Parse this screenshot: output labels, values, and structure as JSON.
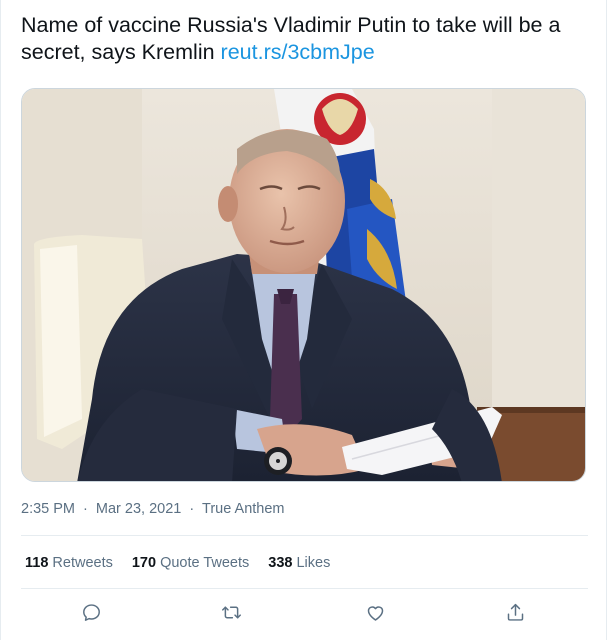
{
  "tweet": {
    "text": "Name of vaccine Russia's Vladimir Putin to take will be a secret, says Kremlin",
    "link": "reut.rs/3cbmJpe",
    "time": "2:35 PM",
    "date": "Mar 23, 2021",
    "source": "True Anthem",
    "separator": "·"
  },
  "stats": {
    "retweets_count": "118",
    "retweets_label": "Retweets",
    "quotes_count": "170",
    "quotes_label": "Quote Tweets",
    "likes_count": "338",
    "likes_label": "Likes"
  },
  "actions": [
    {
      "icon": "reply-icon"
    },
    {
      "icon": "retweet-icon"
    },
    {
      "icon": "like-icon"
    },
    {
      "icon": "share-icon"
    }
  ],
  "colors": {
    "link": "#1b95e0",
    "secondary_text": "#5b7083",
    "divider": "#e6ecf0"
  }
}
